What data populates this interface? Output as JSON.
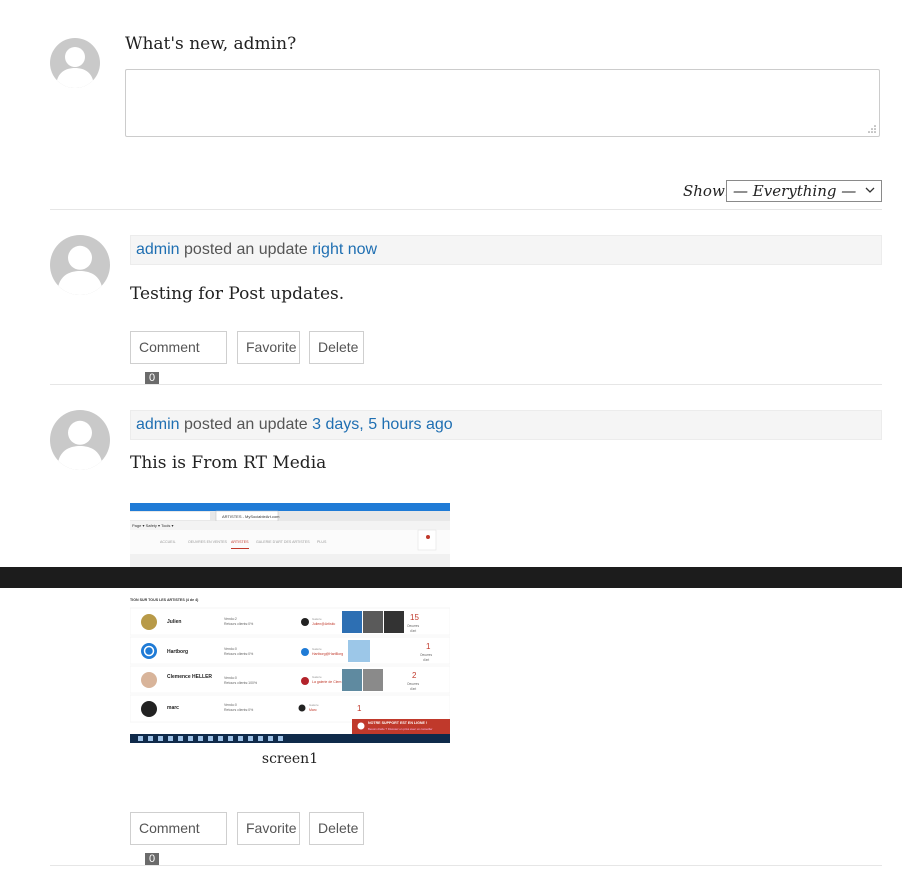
{
  "post_form": {
    "prompt": "What's new, admin?",
    "textarea_value": ""
  },
  "filter": {
    "label": "Show:",
    "selected": "— Everything —"
  },
  "activities": [
    {
      "user": "admin",
      "action": "posted an update",
      "time": "right now",
      "content": "Testing for Post updates.",
      "comment_label": "Comment",
      "comment_count": "0",
      "favorite_label": "Favorite",
      "delete_label": "Delete"
    },
    {
      "user": "admin",
      "action": "posted an update",
      "time": "3 days, 5 hours ago",
      "content": "This is From RT Media",
      "media_caption": "screen1",
      "comment_label": "Comment",
      "comment_count": "0",
      "favorite_label": "Favorite",
      "delete_label": "Delete"
    }
  ],
  "screenshot": {
    "tab": "ARTISTES - MySociableArt.com",
    "nav": [
      "ACCUEIL",
      "OEUVRES EN VENTES",
      "ARTISTES",
      "GALERIE D'ART DES ARTISTES",
      "PLUS"
    ],
    "heading": "TION SUR TOUS LES ARTISTES (4 de 4)",
    "artists": [
      {
        "name": "Julien",
        "stats1": "Vendu:2",
        "stats2": "Retours clients:0%",
        "gal_label": "Galerie",
        "gal": "Julien@Artistic",
        "count": "15",
        "count_label": "Oeuvres",
        "count_sub": "d'art"
      },
      {
        "name": "Hartborg",
        "stats1": "Vendu:0",
        "stats2": "Retours clients:0%",
        "gal_label": "Galerie",
        "gal": "Hartborg@HartBorg",
        "count": "1",
        "count_label": "Oeuvres",
        "count_sub": "d'art"
      },
      {
        "name": "Clemence HELLER",
        "stats1": "Vendu:0",
        "stats2": "Retours clients:100%",
        "gal_label": "Galerie",
        "gal": "La galerie de Clem",
        "count": "2",
        "count_label": "Oeuvres",
        "count_sub": "d'art"
      },
      {
        "name": "marc",
        "stats1": "Vendu:0",
        "stats2": "Retours clients:0%",
        "gal_label": "Galerie",
        "gal": "Marc",
        "count": "1",
        "count_label": "",
        "count_sub": ""
      }
    ],
    "support_title": "NOTRE SUPPORT EST EN LIGNE !",
    "support_text": "Besoin d'aide ? Discutez en privé avec un conseiller"
  }
}
